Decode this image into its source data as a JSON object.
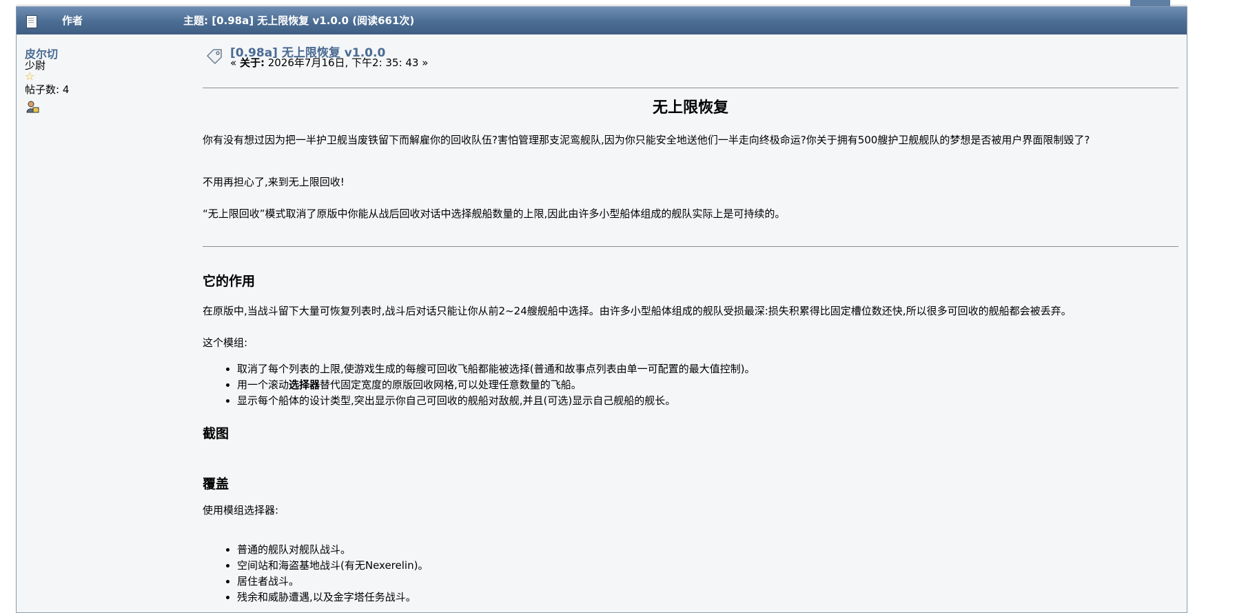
{
  "header": {
    "author_label": "作者",
    "topic_label": "主题: [0.98a] 无上限恢复 v1.0.0 (阅读661次)"
  },
  "poster": {
    "name": "皮尔切",
    "rank": "少尉",
    "star": "☆",
    "posts_label": "帖子数: 4"
  },
  "post": {
    "title": "[0.98a] 无上限恢复 v1.0.0",
    "date_prefix": "« ",
    "date_label": "关于:",
    "date_value": " 2026年7月16日, 下午2: 35: 43 »",
    "heading": "无上限恢复",
    "para1": "你有没有想过因为把一半护卫舰当废铁留下而解雇你的回收队伍?害怕管理那支泥鸾舰队,因为你只能安全地送他们一半走向终极命运?你关于拥有500艘护卫舰舰队的梦想是否被用户界面限制毁了?",
    "para2": "不用再担心了,来到无上限回收!",
    "para3": "“无上限回收”模式取消了原版中你能从战后回收对话中选择舰船数量的上限,因此由许多小型船体组成的舰队实际上是可持续的。",
    "section1": "它的作用",
    "para4": "在原版中,当战斗留下大量可恢复列表时,战斗后对话只能让你从前2~24艘舰船中选择。由许多小型船体组成的舰队受损最深:损失积累得比固定槽位数还快,所以很多可回收的舰船都会被丢弃。",
    "para5": "这个模组:",
    "list1": [
      "取消了每个列表的上限,使游戏生成的每艘可回收飞船都能被选择(普通和故事点列表由单一可配置的最大值控制)。",
      "用一个滚动",
      "选择器",
      "替代固定宽度的原版回收网格,可以处理任意数量的飞船。",
      "显示每个船体的设计类型,突出显示你自己可回收的舰船对敌舰,并且(可选)显示自己舰船的舰长。"
    ],
    "section2": "截图",
    "section3": "覆盖",
    "para6": "使用模组选择器:",
    "list2": [
      "普通的舰队对舰队战斗。",
      "空间站和海盗基地战斗(有无Nexerelin)。",
      "居住者战斗。",
      "残余和威胁遭遇,以及金字塔任务战斗。"
    ]
  },
  "colors": {
    "header_bar": "#4c6d93",
    "link": "#4a6a92",
    "background": "#f4f6f8"
  },
  "icons": [
    "document-icon",
    "post-tag-icon",
    "profile-icon",
    "star-icon"
  ]
}
